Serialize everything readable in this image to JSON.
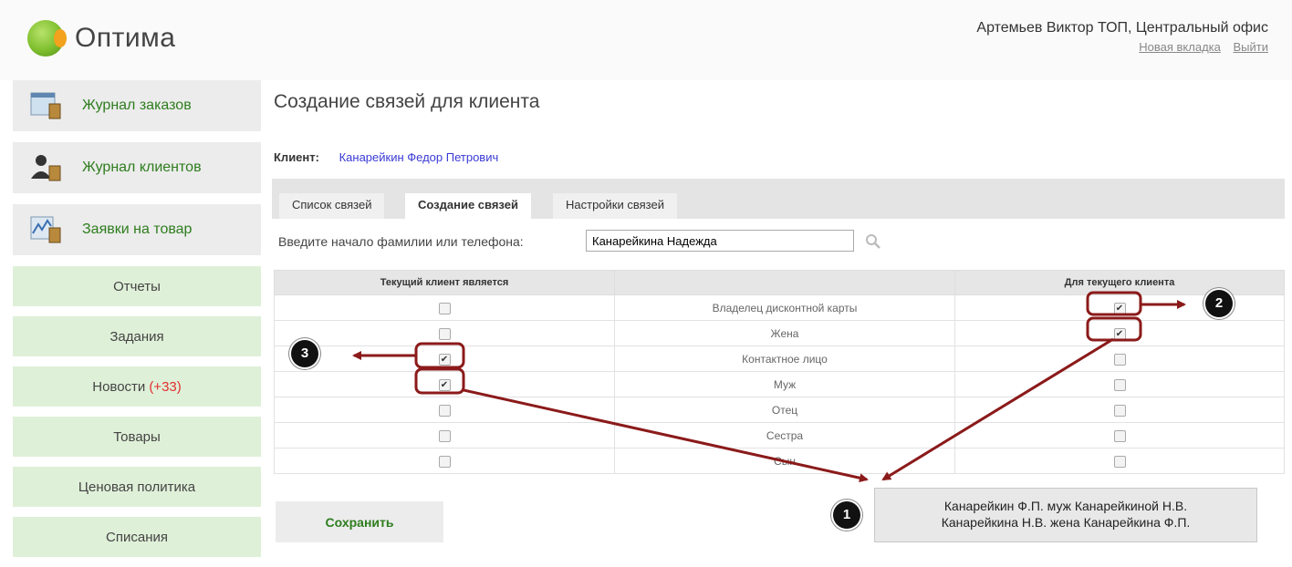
{
  "app": {
    "logo_text": "Оптима",
    "user_name": "Артемьев Виктор ТОП, Центральный офис",
    "new_tab_link": "Новая вкладка",
    "logout_link": "Выйти"
  },
  "sidebar": {
    "icon_items": [
      {
        "label": "Журнал заказов",
        "icon": "orders-icon"
      },
      {
        "label": "Журнал клиентов",
        "icon": "clients-icon"
      },
      {
        "label": "Заявки на товар",
        "icon": "requests-icon"
      }
    ],
    "items": [
      {
        "label": "Отчеты"
      },
      {
        "label": "Задания"
      },
      {
        "label": "Новости",
        "badge": "(+33)"
      },
      {
        "label": "Товары"
      },
      {
        "label": "Ценовая политика"
      },
      {
        "label": "Списания"
      }
    ]
  },
  "main": {
    "title": "Создание связей для клиента",
    "client_label": "Клиент:",
    "client_name": "Канарейкин Федор Петрович",
    "tabs": [
      {
        "label": "Список связей",
        "active": false
      },
      {
        "label": "Создание связей",
        "active": true
      },
      {
        "label": "Настройки связей",
        "active": false
      }
    ],
    "search_label": "Введите начало фамилии или телефона:",
    "search_value": "Канарейкина Надежда",
    "table": {
      "headers": [
        "Текущий клиент является",
        "",
        "Для текущего клиента"
      ],
      "rows": [
        {
          "relation": "Владелец дисконтной карты",
          "current_is": false,
          "for_current": true
        },
        {
          "relation": "Жена",
          "current_is": false,
          "for_current": true
        },
        {
          "relation": "Контактное лицо",
          "current_is": true,
          "for_current": false
        },
        {
          "relation": "Муж",
          "current_is": true,
          "for_current": false
        },
        {
          "relation": "Отец",
          "current_is": false,
          "for_current": false
        },
        {
          "relation": "Сестра",
          "current_is": false,
          "for_current": false
        },
        {
          "relation": "Сын",
          "current_is": false,
          "for_current": false
        }
      ]
    },
    "save_label": "Сохранить"
  },
  "callout": {
    "line1": "Канарейкин Ф.П. муж Канарейкиной Н.В.",
    "line2": "Канарейкина Н.В. жена Канарейкина Ф.П."
  },
  "markers": [
    "1",
    "2",
    "3"
  ],
  "colors": {
    "accent_green": "#2e7d1e",
    "nav_green": "#dff0d8",
    "annotation_red": "#8b1a1a",
    "client_link": "#3a3ad6",
    "badge_red": "#e03030"
  }
}
